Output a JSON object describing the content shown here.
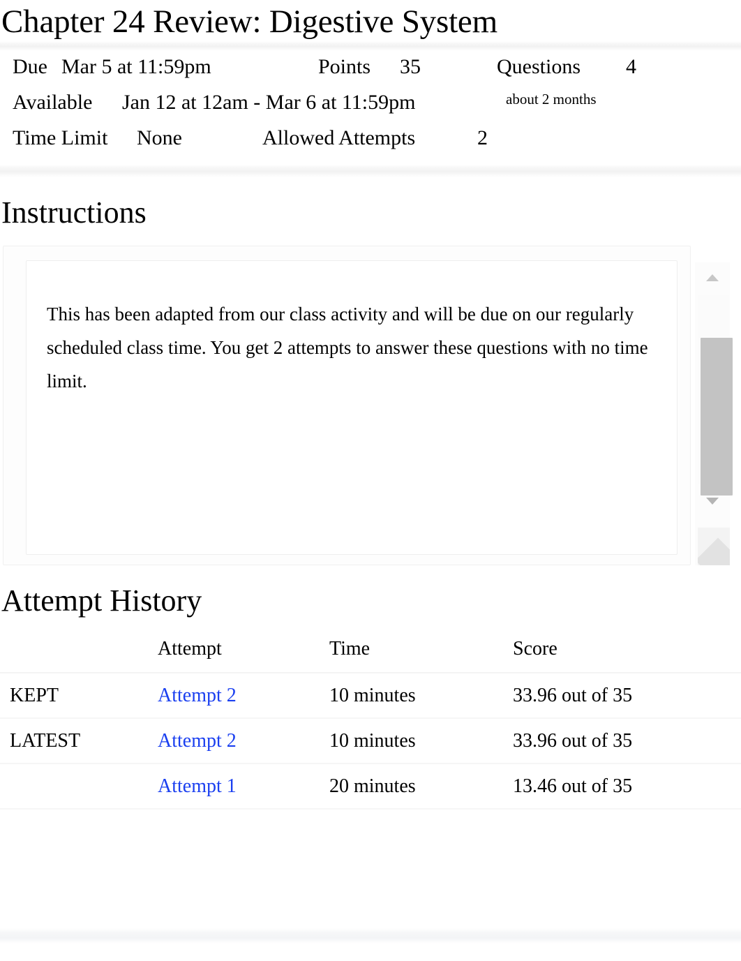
{
  "quiz": {
    "title": "Chapter 24 Review: Digestive System",
    "details": {
      "due_label": "Due",
      "due_value": "Mar 5 at 11:59pm",
      "points_label": "Points",
      "points_value": "35",
      "questions_label": "Questions",
      "questions_value": "4",
      "available_label": "Available",
      "available_value": "Jan 12 at 12am - Mar 6 at 11:59pm",
      "available_note": "about 2 months",
      "time_limit_label": "Time Limit",
      "time_limit_value": "None",
      "allowed_attempts_label": "Allowed Attempts",
      "allowed_attempts_value": "2"
    }
  },
  "instructions": {
    "heading": "Instructions",
    "body": "This has been adapted from our class activity and will be due on our regularly scheduled class time. You get 2 attempts to answer these questions with no time limit.",
    "scrollbar": {
      "up_icon": "triangle-up-icon",
      "down_icon": "triangle-down-icon",
      "resize_icon": "resize-grip-icon"
    }
  },
  "attempt_history": {
    "heading": "Attempt History",
    "columns": [
      "",
      "Attempt",
      "Time",
      "Score"
    ],
    "rows": [
      {
        "label": "KEPT",
        "attempt": "Attempt 2",
        "time": "10 minutes",
        "score": "33.96 out of 35"
      },
      {
        "label": "LATEST",
        "attempt": "Attempt 2",
        "time": "10 minutes",
        "score": "33.96 out of 35"
      },
      {
        "label": "",
        "attempt": "Attempt 1",
        "time": "20 minutes",
        "score": "13.46 out of 35"
      }
    ]
  },
  "colors": {
    "link": "#1a3ff0",
    "text": "#000000",
    "rule": "#f3f3f3",
    "scrollbar_thumb": "#c3c3c3"
  }
}
